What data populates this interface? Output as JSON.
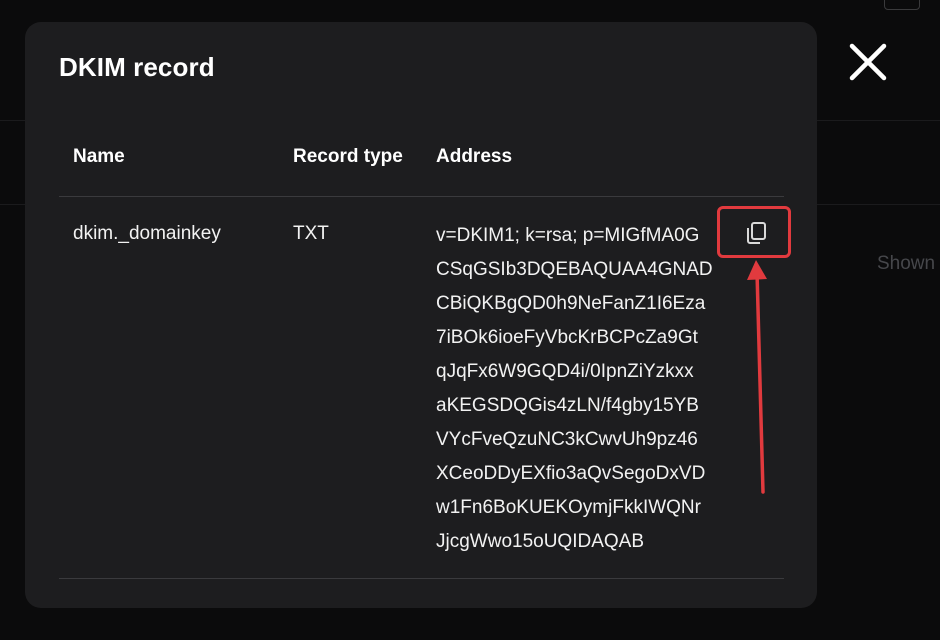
{
  "modal": {
    "title": "DKIM record",
    "columns": {
      "name": "Name",
      "record_type": "Record type",
      "address": "Address"
    },
    "row": {
      "name": "dkim._domainkey",
      "record_type": "TXT",
      "address_lines": [
        "v=DKIM1; k=rsa; p=MIGfMA0G",
        "CSqGSIb3DQEBAQUAA4GNAD",
        "CBiQKBgQD0h9NeFanZ1I6Eza",
        "7iBOk6ioeFyVbcKrBCPcZa9Gt",
        "qJqFx6W9GQD4i/0IpnZiYzkxx",
        "aKEGSDQGis4zLN/f4gby15YB",
        "VYcFveQzuNC3kCwvUh9pz46",
        "XCeoDDyEXfio3aQvSegoDxVD",
        "w1Fn6BoKUEKOymjFkkIWQNr",
        "JjcgWwo15oUQIDAQAB"
      ]
    }
  },
  "background": {
    "shown_text": "Shown"
  },
  "icons": {
    "copy": "copy-icon",
    "close": "close-icon"
  },
  "colors": {
    "modal_bg": "#1d1d1f",
    "page_bg": "#0b0b0c",
    "highlight": "#e13a3e"
  }
}
